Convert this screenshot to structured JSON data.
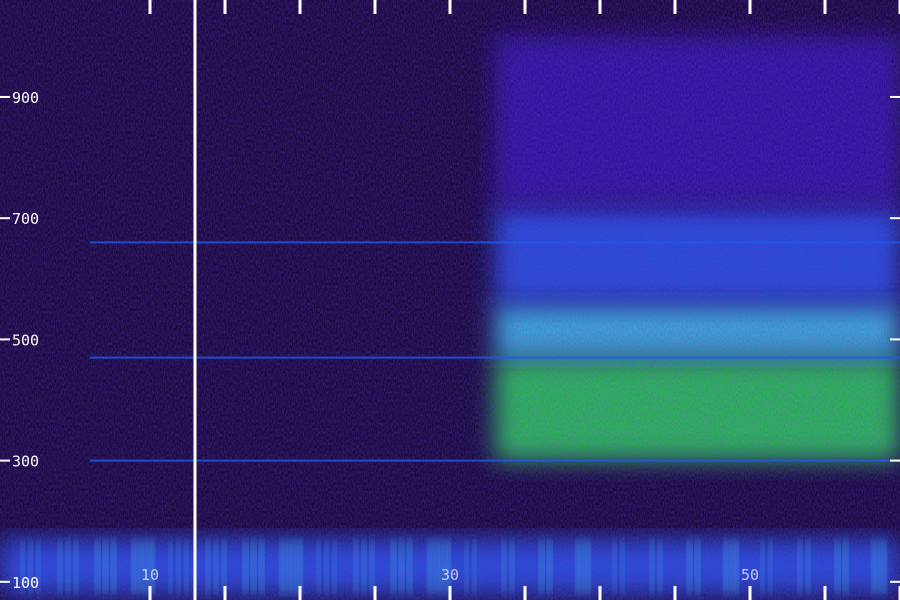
{
  "chart_data": {
    "type": "heatmap",
    "title": "",
    "xlabel": "",
    "ylabel": "",
    "x_ticks": [
      {
        "value": 10,
        "label": "10"
      },
      {
        "value": 30,
        "label": "30"
      },
      {
        "value": 50,
        "label": "50"
      }
    ],
    "y_ticks": [
      {
        "value": 100,
        "label": "100"
      },
      {
        "value": 300,
        "label": "300"
      },
      {
        "value": 500,
        "label": "500"
      },
      {
        "value": 700,
        "label": "700"
      },
      {
        "value": 900,
        "label": "900"
      }
    ],
    "x_minor_ticks": [
      10,
      13,
      15,
      20,
      25,
      30,
      35,
      40,
      45,
      50,
      55,
      60
    ],
    "xlim": [
      0,
      60
    ],
    "ylim": [
      70,
      1060
    ],
    "cursor_x": 13,
    "colors": {
      "background": "#0a0020",
      "low": "#2a10a0",
      "mid": "#1e5af0",
      "high": "#38d8f0",
      "peak": "#22f040",
      "axis": "#ffffff"
    },
    "energy_regions": [
      {
        "x": [
          33,
          60
        ],
        "y": [
          300,
          470
        ],
        "level": 1.0
      },
      {
        "x": [
          33,
          60
        ],
        "y": [
          470,
          560
        ],
        "level": 0.8
      },
      {
        "x": [
          33,
          60
        ],
        "y": [
          560,
          720
        ],
        "level": 0.5
      },
      {
        "x": [
          33,
          60
        ],
        "y": [
          720,
          1000
        ],
        "level": 0.35
      },
      {
        "x": [
          0,
          60
        ],
        "y": [
          80,
          170
        ],
        "level": 0.6
      }
    ],
    "horizontal_lines_hz": [
      660,
      470,
      300
    ]
  }
}
